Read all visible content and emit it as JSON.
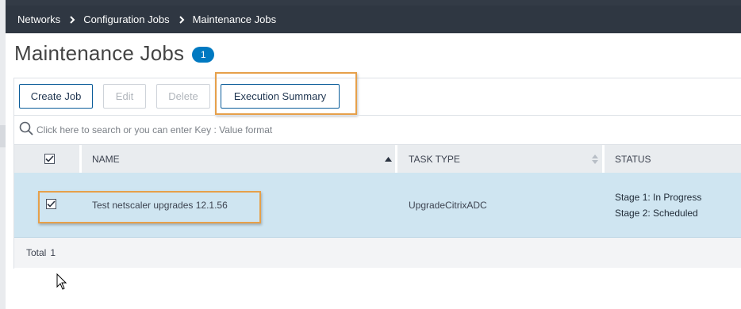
{
  "breadcrumb": {
    "items": [
      "Networks",
      "Configuration Jobs",
      "Maintenance Jobs"
    ]
  },
  "page": {
    "title": "Maintenance Jobs",
    "count_badge": "1"
  },
  "toolbar": {
    "create_label": "Create Job",
    "edit_label": "Edit",
    "delete_label": "Delete",
    "execution_summary_label": "Execution Summary"
  },
  "search": {
    "placeholder": "Click here to search or you can enter Key : Value format"
  },
  "table": {
    "columns": {
      "name": "NAME",
      "task_type": "TASK TYPE",
      "status": "STATUS"
    },
    "rows": [
      {
        "selected": true,
        "name": "Test netscaler upgrades 12.1.56",
        "task_type": "UpgradeCitrixADC",
        "status": [
          {
            "label": "Stage 1:",
            "value": "In Progress"
          },
          {
            "label": "Stage 2:",
            "value": "Scheduled"
          }
        ]
      }
    ],
    "footer": {
      "total_label": "Total",
      "total_value": "1"
    }
  },
  "colors": {
    "nav_bg": "#2f3742",
    "accent": "#0079c1",
    "selected_row": "#cfe5f1",
    "highlight": "#e6a04a"
  }
}
